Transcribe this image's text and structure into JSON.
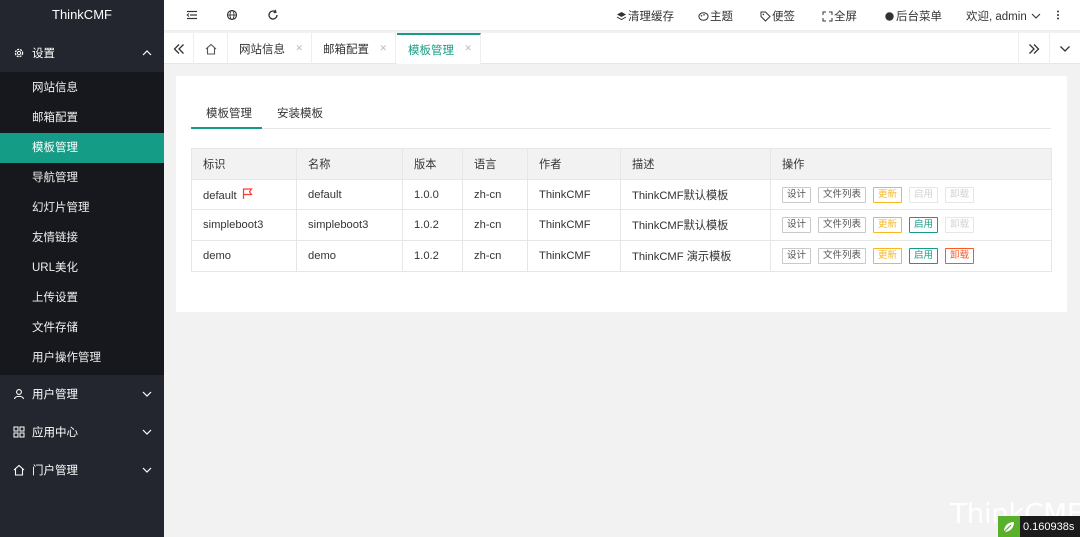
{
  "app": {
    "logo": "ThinkCMF"
  },
  "sidebar": {
    "groups": [
      {
        "label": "设置",
        "expanded": true,
        "icon": "gear-icon",
        "items": [
          "网站信息",
          "邮箱配置",
          "模板管理",
          "导航管理",
          "幻灯片管理",
          "友情链接",
          "URL美化",
          "上传设置",
          "文件存储",
          "用户操作管理"
        ],
        "active_item": "模板管理"
      },
      {
        "label": "用户管理",
        "expanded": false,
        "icon": "user-icon"
      },
      {
        "label": "应用中心",
        "expanded": false,
        "icon": "app-icon"
      },
      {
        "label": "门户管理",
        "expanded": false,
        "icon": "home-icon"
      }
    ]
  },
  "topbar": {
    "clear_cache": "清理缓存",
    "theme": "主题",
    "note": "便签",
    "fullscreen": "全屏",
    "backend_menu": "后台菜单",
    "welcome": "欢迎, admin"
  },
  "tabs": [
    {
      "label": "网站信息",
      "active": false
    },
    {
      "label": "邮箱配置",
      "active": false
    },
    {
      "label": "模板管理",
      "active": true
    }
  ],
  "content": {
    "tabs": [
      "模板管理",
      "安装模板"
    ],
    "table": {
      "headers": [
        "标识",
        "名称",
        "版本",
        "语言",
        "作者",
        "描述",
        "操作"
      ],
      "rows": [
        {
          "id": "default",
          "name": "default",
          "version": "1.0.0",
          "lang": "zh-cn",
          "author": "ThinkCMF",
          "desc": "ThinkCMF默认模板",
          "flag": true
        },
        {
          "id": "simpleboot3",
          "name": "simpleboot3",
          "version": "1.0.2",
          "lang": "zh-cn",
          "author": "ThinkCMF",
          "desc": "ThinkCMF默认模板",
          "flag": false
        },
        {
          "id": "demo",
          "name": "demo",
          "version": "1.0.2",
          "lang": "zh-cn",
          "author": "ThinkCMF",
          "desc": "ThinkCMF 演示模板",
          "flag": false
        }
      ],
      "op_labels": {
        "design": "设计",
        "files": "文件列表",
        "update": "更新",
        "enable": "启用",
        "uninstall": "卸载"
      }
    }
  },
  "colors": {
    "accent": "#159c86",
    "sidebar_bg": "#23262e",
    "update": "#f7b824",
    "danger": "#ff5722"
  },
  "overlay": {
    "watermark": "ThinkCMF",
    "timer": "0.160938s"
  }
}
